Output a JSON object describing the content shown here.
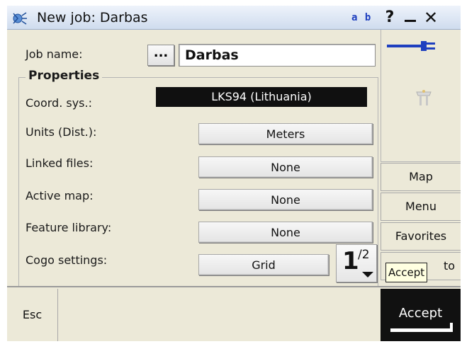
{
  "window": {
    "title": "New job: Darbas",
    "input_indicator": "a b",
    "help_label": "?",
    "close_label": "✕"
  },
  "form": {
    "job_name_label": "Job name:",
    "browse_label": "...",
    "job_name_value": "Darbas",
    "properties_title": "Properties",
    "rows": [
      {
        "label": "Coord. sys.:",
        "value": "LKS94 (Lithuania)"
      },
      {
        "label": "Units (Dist.):",
        "value": "Meters"
      },
      {
        "label": "Linked files:",
        "value": "None"
      },
      {
        "label": "Active map:",
        "value": "None"
      },
      {
        "label": "Feature library:",
        "value": "None"
      },
      {
        "label": "Cogo settings:",
        "value": "Grid"
      }
    ],
    "page": {
      "current": "1",
      "total": "/2"
    }
  },
  "sidebar": {
    "map": "Map",
    "menu": "Menu",
    "favorites": "Favorites",
    "goto_tail": "to",
    "tooltip": "Accept"
  },
  "bottom": {
    "esc": "Esc",
    "accept": "Accept"
  }
}
